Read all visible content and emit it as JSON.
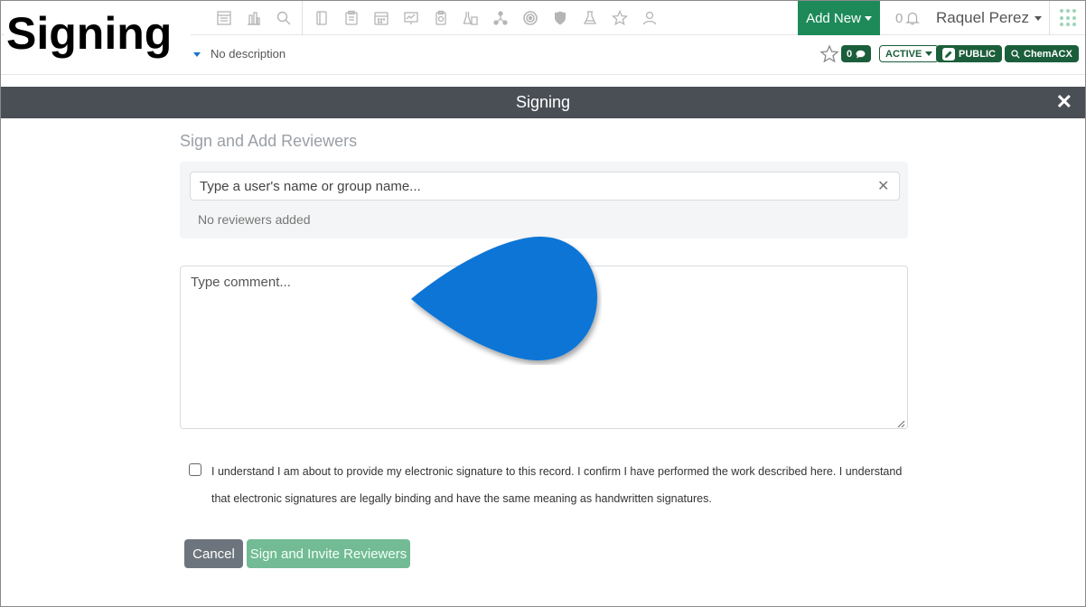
{
  "caption": "Signing",
  "topnav": {
    "icons": [
      "reports-icon",
      "chart-icon",
      "search-icon",
      "notebook-icon",
      "clipboard-icon",
      "calendar-icon",
      "presentation-icon",
      "sample-icon",
      "flask-rack-icon",
      "molecule-icon",
      "target-icon",
      "shield-icon",
      "beaker-icon",
      "star-icon",
      "users-icon"
    ],
    "add_new_label": "Add New",
    "notification_count": "0",
    "user_name": "Raquel Perez"
  },
  "subbar": {
    "description": "No description",
    "comment_count": "0",
    "status_label": "ACTIVE",
    "visibility_label": "PUBLIC",
    "chem_label": "ChemACX"
  },
  "modal": {
    "title": "Signing",
    "close_glyph": "✕",
    "section_title": "Sign and Add Reviewers",
    "reviewer_placeholder": "Type a user's name or group name...",
    "reviewer_clear_glyph": "✕",
    "no_reviewers_text": "No reviewers added",
    "comment_placeholder": "Type comment...",
    "agreement_text": "I understand I am about to provide my electronic signature to this record. I confirm I have performed the work described here. I understand that electronic signatures are legally binding and have the same meaning as handwritten signatures.",
    "cancel_label": "Cancel",
    "sign_label": "Sign and Invite Reviewers"
  },
  "colors": {
    "brand_green": "#1e8a5a",
    "dark_green": "#1b5e3b",
    "modal_header": "#4a4f55",
    "pointer_blue": "#0b74d6",
    "sign_button": "#72bb94",
    "cancel_button": "#6c757d"
  }
}
